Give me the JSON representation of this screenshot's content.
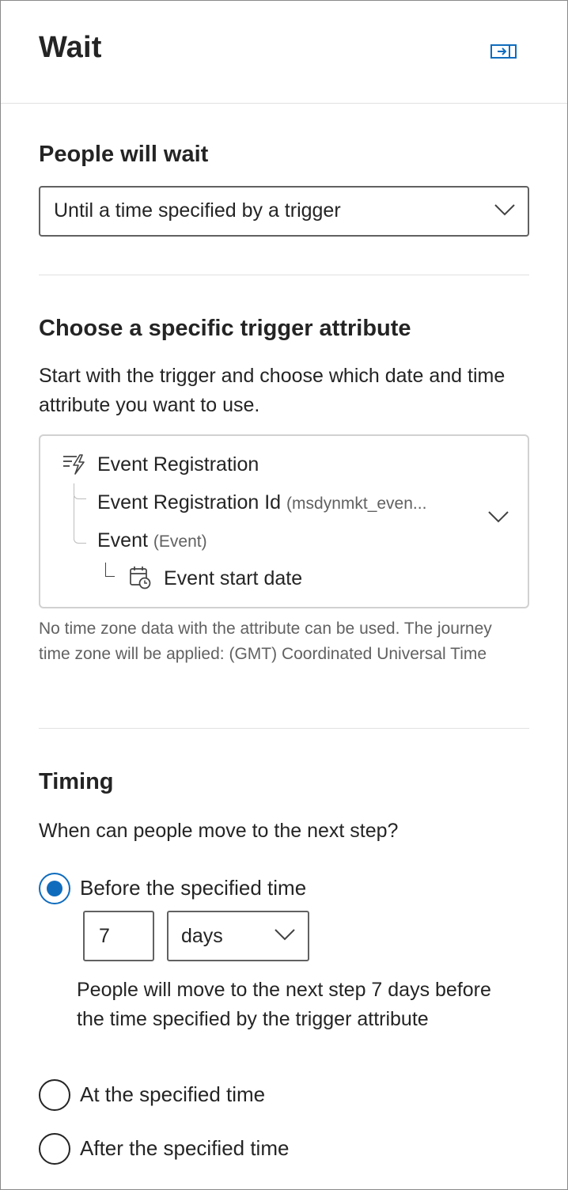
{
  "header": {
    "title": "Wait",
    "collapse_icon": "panel-collapse-icon"
  },
  "wait_mode": {
    "label": "People will wait",
    "selected": "Until a time specified by a trigger"
  },
  "trigger_attribute": {
    "title": "Choose a specific trigger attribute",
    "description": "Start with the trigger and choose which date and time attribute you want to use.",
    "tree": {
      "trigger_name": "Event Registration",
      "level1_name": "Event Registration Id",
      "level1_sub": "(msdynmkt_even...",
      "level2_name": "Event",
      "level2_sub": "(Event)",
      "attribute_name": "Event start date"
    },
    "timezone_note": "No time zone data with the attribute can be used. The journey time zone will be applied: (GMT) Coordinated Universal Time"
  },
  "timing": {
    "title": "Timing",
    "question": "When can people move to the next step?",
    "options": [
      {
        "label": "Before the specified time",
        "checked": true
      },
      {
        "label": "At the specified time",
        "checked": false
      },
      {
        "label": "After the specified time",
        "checked": false
      }
    ],
    "amount": "7",
    "unit": "days",
    "explanation": "People will move to the next step 7 days before the time specified by the trigger attribute"
  },
  "colors": {
    "accent": "#0f6cbd",
    "text": "#242424",
    "secondary_text": "#616161",
    "border": "#616161",
    "divider": "#e1e1e1"
  }
}
